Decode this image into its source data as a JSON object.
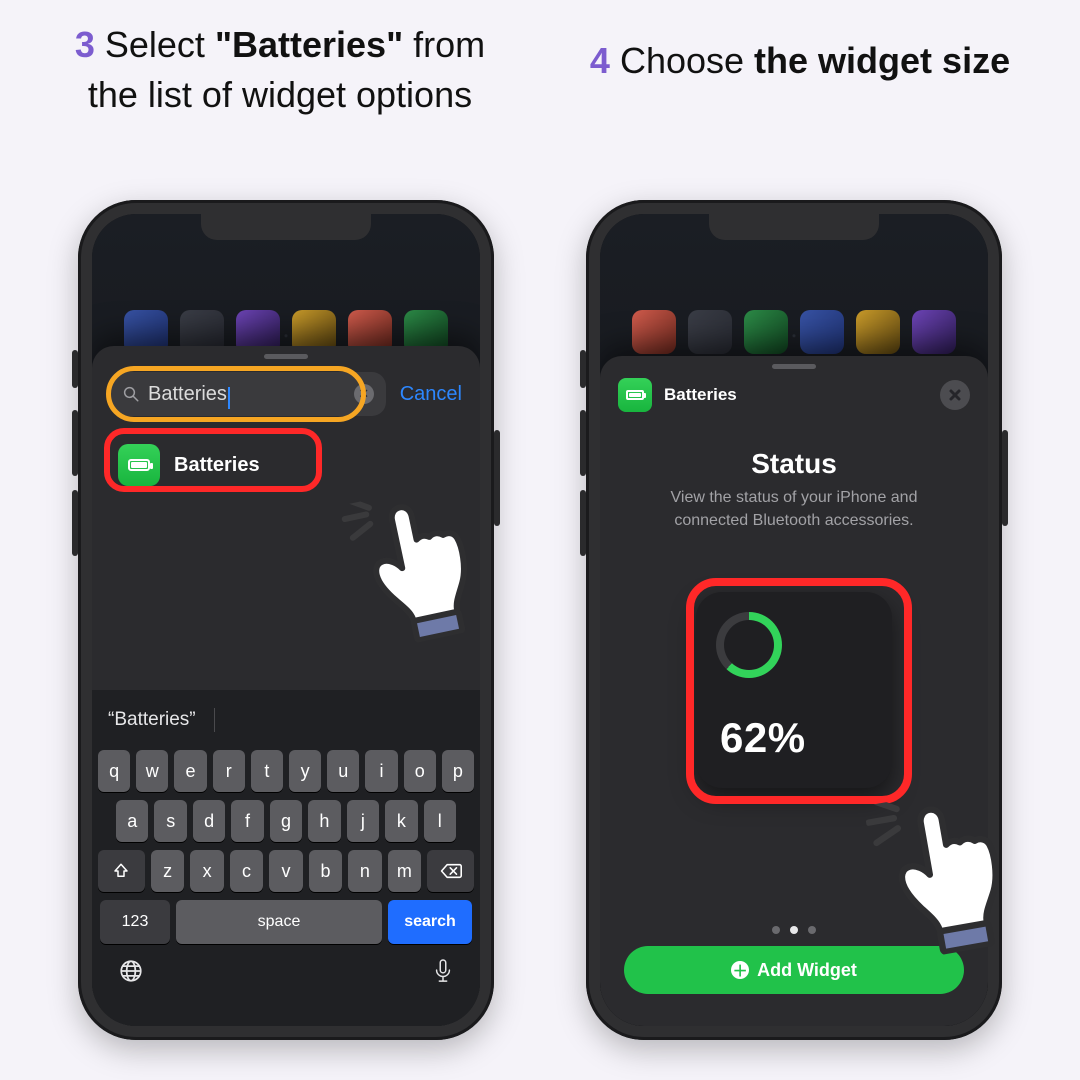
{
  "step3": {
    "number": "3",
    "text_prefix": "Select ",
    "bold": "\"Batteries\"",
    "text_suffix": " from the list of widget options"
  },
  "step4": {
    "number": "4",
    "text_prefix": "Choose ",
    "bold": "the widget size",
    "text_suffix": ""
  },
  "left": {
    "search_value": "Batteries",
    "cancel": "Cancel",
    "result_label": "Batteries",
    "suggestion": "“Batteries”",
    "keys_row1": [
      "q",
      "w",
      "e",
      "r",
      "t",
      "y",
      "u",
      "i",
      "o",
      "p"
    ],
    "keys_row2": [
      "a",
      "s",
      "d",
      "f",
      "g",
      "h",
      "j",
      "k",
      "l"
    ],
    "keys_row3": [
      "z",
      "x",
      "c",
      "v",
      "b",
      "n",
      "m"
    ],
    "key_123": "123",
    "key_space": "space",
    "key_search": "search"
  },
  "right": {
    "header_title": "Batteries",
    "status_title": "Status",
    "status_sub": "View the status of your iPhone and connected Bluetooth accessories.",
    "percent_text": "62%",
    "add_widget": "Add Widget"
  }
}
